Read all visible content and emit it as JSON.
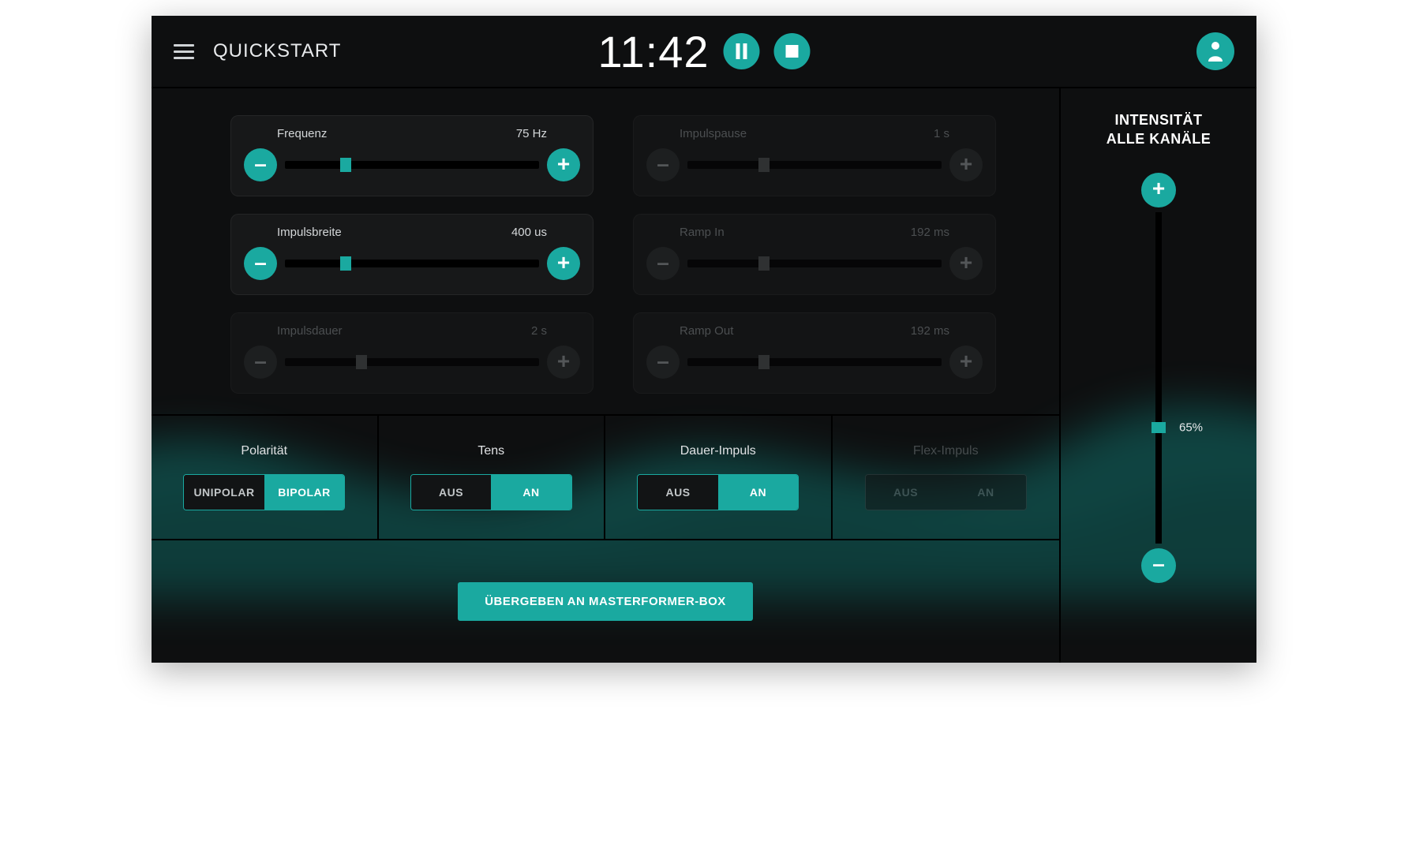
{
  "colors": {
    "accent": "#1aa9a0"
  },
  "header": {
    "title": "QUICKSTART",
    "timer": "11:42"
  },
  "sliders": [
    {
      "id": "frequenz",
      "label": "Frequenz",
      "value": "75 Hz",
      "percent": 24,
      "enabled": true
    },
    {
      "id": "impulspause",
      "label": "Impulspause",
      "value": "1 s",
      "percent": 30,
      "enabled": false
    },
    {
      "id": "impulsbreite",
      "label": "Impulsbreite",
      "value": "400 us",
      "percent": 24,
      "enabled": true
    },
    {
      "id": "ramp_in",
      "label": "Ramp In",
      "value": "192 ms",
      "percent": 30,
      "enabled": false
    },
    {
      "id": "impulsdauer",
      "label": "Impulsdauer",
      "value": "2 s",
      "percent": 30,
      "enabled": false
    },
    {
      "id": "ramp_out",
      "label": "Ramp Out",
      "value": "192 ms",
      "percent": 30,
      "enabled": false
    }
  ],
  "toggles": [
    {
      "id": "polaritaet",
      "title": "Polarität",
      "left": "UNIPOLAR",
      "right": "BIPOLAR",
      "selected": "right",
      "enabled": true
    },
    {
      "id": "tens",
      "title": "Tens",
      "left": "AUS",
      "right": "AN",
      "selected": "right",
      "enabled": true
    },
    {
      "id": "dauer_impuls",
      "title": "Dauer-Impuls",
      "left": "AUS",
      "right": "AN",
      "selected": "right",
      "enabled": true
    },
    {
      "id": "flex_impuls",
      "title": "Flex-Impuls",
      "left": "AUS",
      "right": "AN",
      "selected": "none",
      "enabled": false
    }
  ],
  "intensity": {
    "title_line1": "INTENSITÄT",
    "title_line2": "ALLE KANÄLE",
    "value_label": "65%",
    "percent": 65
  },
  "footer": {
    "primary_button": "ÜBERGEBEN AN MASTERFORMER-BOX"
  }
}
